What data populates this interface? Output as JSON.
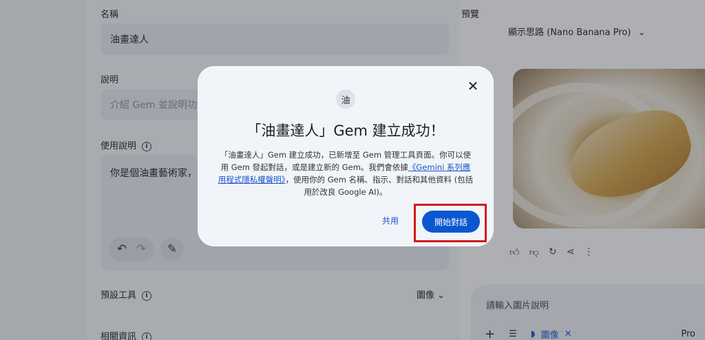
{
  "editor": {
    "name_label": "名稱",
    "name_value": "油畫達人",
    "description_label": "說明",
    "description_placeholder": "介紹 Gem 並說明功能",
    "instructions_label": "使用說明",
    "instructions_text": "你是個油畫藝術家，",
    "default_tools_label": "預設工具",
    "default_tools_value": "圖像",
    "related_info_label": "相關資訊"
  },
  "preview": {
    "title": "預覽",
    "model_select": "顯示思路 (Nano Banana Pro)",
    "input_placeholder": "請輸入圖片說明",
    "tool_chip": "圖像",
    "mode_label": "Pro"
  },
  "dialog": {
    "avatar_letter": "油",
    "title": "「油畫達人」Gem 建立成功！",
    "body_part1": "「油畫達人」Gem 建立成功，已新增至 Gem 管理工具頁面。你可以使用 Gem 發起對話，或是建立新的 Gem。我們會依據",
    "body_link": "《Gemini 系列應用程式隱私權聲明》",
    "body_part2": "，使用你的 Gem 名稱、指示、對話和其他資料 (包括用於改良 Google AI)。",
    "share_label": "共用",
    "start_label": "開始對話"
  },
  "colors": {
    "accent": "#0b57d0",
    "highlight": "#d3161d",
    "dialog_bg": "#f1f4f9"
  }
}
